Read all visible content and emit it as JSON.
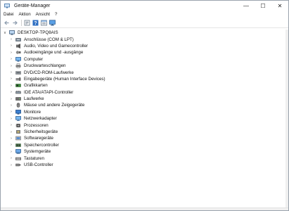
{
  "window": {
    "title": "Geräte-Manager",
    "minimize": "—",
    "maximize": "☐",
    "close": "✕"
  },
  "menu": {
    "file": "Datei",
    "action": "Aktion",
    "view": "Ansicht",
    "help": "?"
  },
  "tree": {
    "root": "DESKTOP-TPQ8AIS",
    "items": [
      "Anschlüsse (COM & LPT)",
      "Audio, Video und Gamecontroller",
      "Audioeingänge und -ausgänge",
      "Computer",
      "Druckwarteschlangen",
      "DVD/CD-ROM-Laufwerke",
      "Eingabegeräte (Human Interface Devices)",
      "Grafikkarten",
      "IDE ATA/ATAPI-Controller",
      "Laufwerke",
      "Mäuse und andere Zeigegeräte",
      "Monitore",
      "Netzwerkadapter",
      "Prozessoren",
      "Sicherheitsgeräte",
      "Softwaregeräte",
      "Speichercontroller",
      "Systemgeräte",
      "Tastaturen",
      "USB-Controller"
    ]
  },
  "icons": [
    "port-icon",
    "audio-video-icon",
    "audio-io-icon",
    "computer-icon",
    "print-queue-icon",
    "dvd-drive-icon",
    "hid-icon",
    "graphics-card-icon",
    "ide-controller-icon",
    "disk-drive-icon",
    "mouse-icon",
    "monitor-icon",
    "network-adapter-icon",
    "processor-icon",
    "security-device-icon",
    "software-device-icon",
    "storage-controller-icon",
    "system-device-icon",
    "keyboard-icon",
    "usb-controller-icon"
  ]
}
